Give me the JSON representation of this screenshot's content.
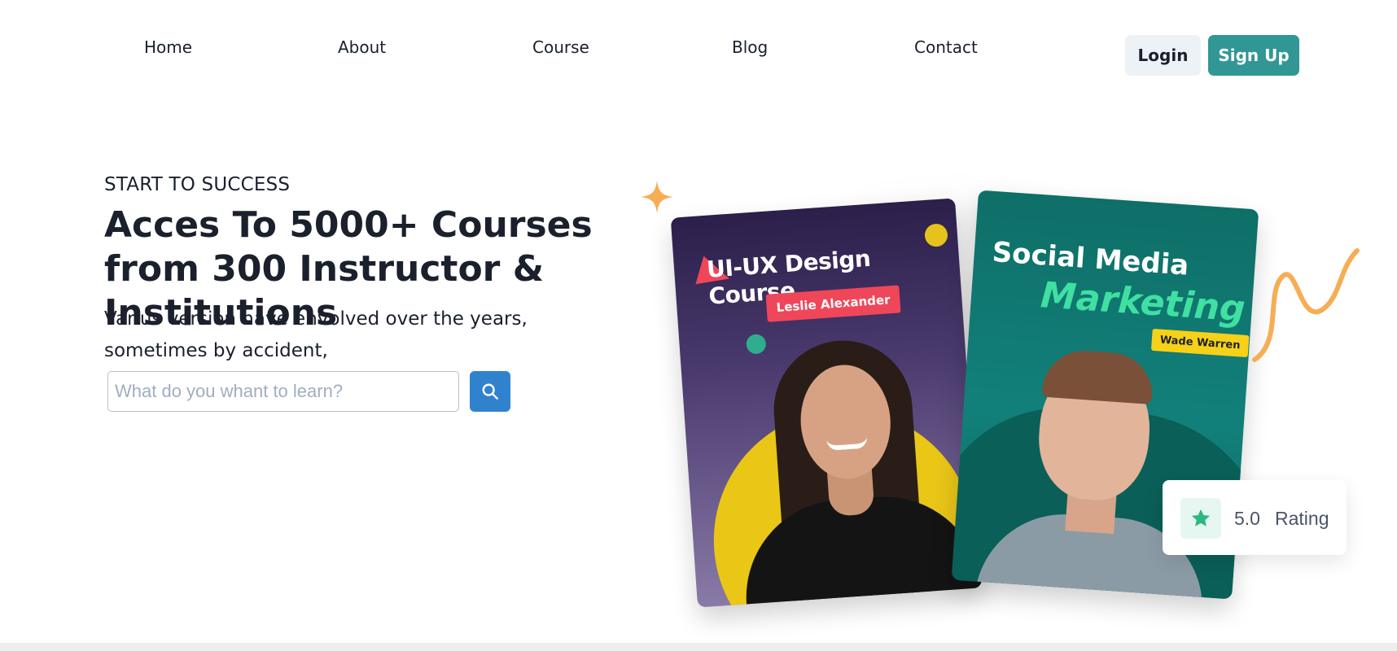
{
  "nav": {
    "links": [
      "Home",
      "About",
      "Course",
      "Blog",
      "Contact"
    ],
    "login_label": "Login",
    "signup_label": "Sign Up"
  },
  "hero": {
    "eyebrow": "START TO SUCCESS",
    "headline": "Acces To 5000+ Courses from 300 Instructor & Institutions",
    "subtext": "Varius version have envolved over the years, sometimes by accident,",
    "search": {
      "placeholder": "What do you whant to learn?",
      "value": ""
    }
  },
  "cards": {
    "design": {
      "title": "UI-UX Design Course",
      "instructor": "Leslie Alexander"
    },
    "marketing": {
      "title_line1": "Social Media",
      "title_line2": "Marketing",
      "instructor": "Wade Warren"
    }
  },
  "rating": {
    "value": "5.0",
    "label": "Rating"
  },
  "colors": {
    "primary_teal": "#319795",
    "search_blue": "#3182ce",
    "accent_orange": "#f6ad55",
    "rating_star": "#2db87d"
  }
}
